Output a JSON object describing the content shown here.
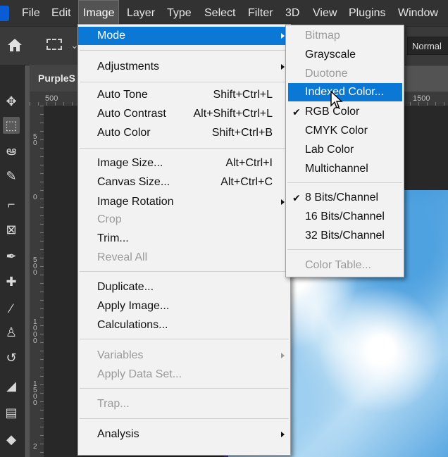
{
  "menubar": {
    "items": [
      "File",
      "Edit",
      "Image",
      "Layer",
      "Type",
      "Select",
      "Filter",
      "3D",
      "View",
      "Plugins",
      "Window"
    ],
    "active": "Image"
  },
  "options_bar": {
    "blend_mode": "Normal"
  },
  "document": {
    "tab_title": "PurpleS",
    "ruler_h": [
      "500",
      "1500"
    ],
    "ruler_v": [
      "5\n0",
      "0",
      "5\n0\n0",
      "1\n0\n0\n0",
      "1\n5\n0\n0",
      "2"
    ]
  },
  "image_menu": {
    "items": [
      {
        "label": "Mode",
        "submenu": true,
        "highlighted": true
      },
      {
        "label": "Adjustments",
        "submenu": true
      },
      {
        "label": "Auto Tone",
        "shortcut": "Shift+Ctrl+L"
      },
      {
        "label": "Auto Contrast",
        "shortcut": "Alt+Shift+Ctrl+L"
      },
      {
        "label": "Auto Color",
        "shortcut": "Shift+Ctrl+B"
      },
      {
        "label": "Image Size...",
        "shortcut": "Alt+Ctrl+I"
      },
      {
        "label": "Canvas Size...",
        "shortcut": "Alt+Ctrl+C"
      },
      {
        "label": "Image Rotation",
        "submenu": true
      },
      {
        "label": "Crop",
        "disabled": true
      },
      {
        "label": "Trim..."
      },
      {
        "label": "Reveal All",
        "disabled": true
      },
      {
        "label": "Duplicate..."
      },
      {
        "label": "Apply Image..."
      },
      {
        "label": "Calculations..."
      },
      {
        "label": "Variables",
        "submenu": true,
        "disabled": true
      },
      {
        "label": "Apply Data Set...",
        "disabled": true
      },
      {
        "label": "Trap...",
        "disabled": true
      },
      {
        "label": "Analysis",
        "submenu": true
      }
    ]
  },
  "mode_menu": {
    "items": [
      {
        "label": "Bitmap",
        "disabled": true
      },
      {
        "label": "Grayscale"
      },
      {
        "label": "Duotone",
        "disabled": true
      },
      {
        "label": "Indexed Color...",
        "highlighted": true
      },
      {
        "label": "RGB Color",
        "checked": true
      },
      {
        "label": "CMYK Color"
      },
      {
        "label": "Lab Color"
      },
      {
        "label": "Multichannel"
      },
      {
        "label": "8 Bits/Channel",
        "checked": true
      },
      {
        "label": "16 Bits/Channel"
      },
      {
        "label": "32 Bits/Channel"
      },
      {
        "label": "Color Table...",
        "disabled": true
      }
    ]
  },
  "colors": {
    "highlight": "#0b78d6",
    "menu_bg": "#f2f2f2",
    "app_bg": "#323232"
  },
  "check_glyph": "✔"
}
